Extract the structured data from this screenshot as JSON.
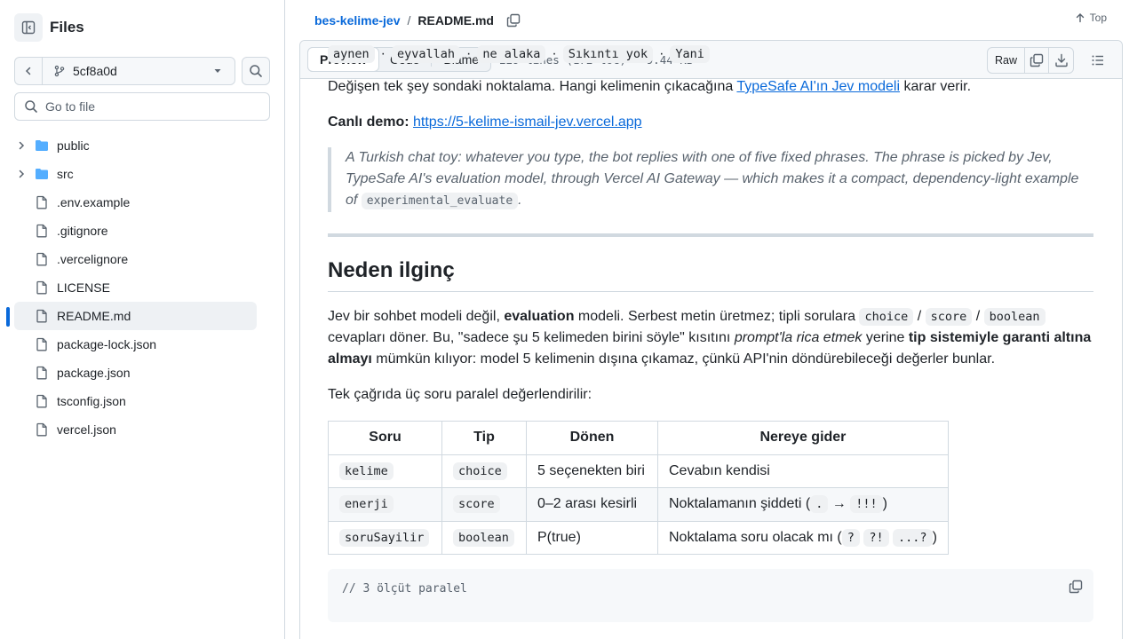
{
  "sidebar": {
    "title": "Files",
    "branch": "5cf8a0d",
    "goto_placeholder": "Go to file",
    "items": [
      {
        "label": "public",
        "type": "folder"
      },
      {
        "label": "src",
        "type": "folder"
      },
      {
        "label": ".env.example",
        "type": "file"
      },
      {
        "label": ".gitignore",
        "type": "file"
      },
      {
        "label": ".vercelignore",
        "type": "file"
      },
      {
        "label": "LICENSE",
        "type": "file"
      },
      {
        "label": "README.md",
        "type": "file",
        "active": true
      },
      {
        "label": "package-lock.json",
        "type": "file"
      },
      {
        "label": "package.json",
        "type": "file"
      },
      {
        "label": "tsconfig.json",
        "type": "file"
      },
      {
        "label": "vercel.json",
        "type": "file"
      }
    ]
  },
  "breadcrumb": {
    "repo": "bes-kelime-jev",
    "sep": "/",
    "file": "README.md"
  },
  "top_link": "Top",
  "file_header": {
    "tabs": [
      "Preview",
      "Code",
      "Blame"
    ],
    "selected_tab": "Preview",
    "meta": "229 lines (172 loc) · 9.44 KB",
    "raw": "Raw"
  },
  "readme": {
    "phrases": [
      "aynen",
      "eyvallah",
      "ne alaka",
      "Sıkıntı yok",
      "Yani"
    ],
    "phrase_sep": "·",
    "p1_before": "Değişen tek şey sondaki noktalama. Hangi kelimenin çıkacağına ",
    "p1_link": "TypeSafe AI'ın Jev modeli",
    "p1_after": " karar verir.",
    "p2_bold": "Canlı demo:",
    "p2_link": "https://5-kelime-ismail-jev.vercel.app",
    "quote_text": "A Turkish chat toy: whatever you type, the bot replies with one of five fixed phrases. The phrase is picked by Jev, TypeSafe AI's evaluation model, through Vercel AI Gateway — which makes it a compact, dependency-light example of ",
    "quote_code": "experimental_evaluate",
    "quote_end": ".",
    "h2": "Neden ilginç",
    "p3": {
      "t1": "Jev bir sohbet modeli değil, ",
      "b1": "evaluation",
      "t2": " modeli. Serbest metin üretmez; tipli sorulara ",
      "c1": "choice",
      "s1": " / ",
      "c2": "score",
      "s2": " / ",
      "c3": "boolean",
      "t3": " cevapları döner. Bu, \"sadece şu 5 kelimeden birini söyle\" kısıtını ",
      "i1": "prompt'la rica etmek",
      "t4": " yerine ",
      "b2": "tip sistemiyle garanti altına almayı",
      "t5": " mümkün kılıyor: model 5 kelimenin dışına çıkamaz, çünkü API'nin döndürebileceği değerler bunlar."
    },
    "p4": "Tek çağrıda üç soru paralel değerlendirilir:",
    "table": {
      "headers": [
        "Soru",
        "Tip",
        "Dönen",
        "Nereye gider"
      ],
      "rows": [
        {
          "soru": "kelime",
          "tip": "choice",
          "donen": "5 seçenekten biri",
          "nereye": "Cevabın kendisi"
        },
        {
          "soru": "enerji",
          "tip": "score",
          "donen": "0–2 arası kesirli",
          "nereye_pre": "Noktalamanın şiddeti (",
          "c1": ".",
          "arrow": " → ",
          "c2": "!!!",
          "nereye_post": ")"
        },
        {
          "soru": "soruSayilir",
          "tip": "boolean",
          "donen": "P(true)",
          "nereye_pre": "Noktalama soru olacak mı (",
          "c1": "?",
          "c2": "?!",
          "c3": "...?",
          "nereye_post": ")"
        }
      ]
    },
    "code_snippet": "// 3 ölçüt paralel"
  }
}
